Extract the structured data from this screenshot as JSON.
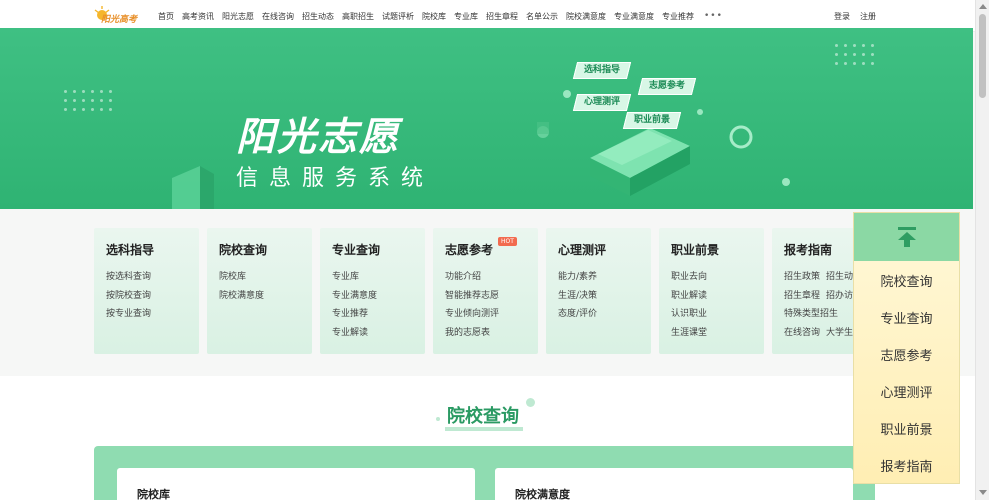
{
  "logo": {
    "text": "阳光高考"
  },
  "nav": {
    "items": [
      "首页",
      "高考资讯",
      "阳光志愿",
      "在线咨询",
      "招生动态",
      "高职招生",
      "试题评析",
      "院校库",
      "专业库",
      "招生章程",
      "名单公示",
      "院校满意度",
      "专业满意度",
      "专业推荐"
    ],
    "more": "•••"
  },
  "auth": {
    "login": "登录",
    "register": "注册"
  },
  "banner": {
    "title": "阳光志愿",
    "subtitle": "信息服务系统",
    "tags": [
      "选科指导",
      "志愿参考",
      "心理测评",
      "职业前景"
    ]
  },
  "categories": [
    {
      "title": "选科指导",
      "links": [
        "按选科查询",
        "按院校查询",
        "按专业查询"
      ]
    },
    {
      "title": "院校查询",
      "links": [
        "院校库",
        "院校满意度"
      ]
    },
    {
      "title": "专业查询",
      "links": [
        "专业库",
        "专业满意度",
        "专业推荐",
        "专业解读"
      ]
    },
    {
      "title": "志愿参考",
      "badge": "HOT",
      "links": [
        "功能介绍",
        "智能推荐志愿",
        "专业倾向测评",
        "我的志愿表"
      ]
    },
    {
      "title": "心理测评",
      "links": [
        "能力/素养",
        "生涯/决策",
        "态度/评价"
      ]
    },
    {
      "title": "职业前景",
      "links": [
        "职业去向",
        "职业解读",
        "认识职业",
        "生涯课堂"
      ]
    },
    {
      "title": "报考指南",
      "pairs": [
        [
          "招生政策",
          "招生动"
        ],
        [
          "招生章程",
          "招办访"
        ],
        [
          "特殊类型招生",
          ""
        ],
        [
          "在线咨询",
          "大学生"
        ]
      ]
    }
  ],
  "section": {
    "title": "院校查询",
    "cards": [
      "院校库",
      "院校满意度"
    ]
  },
  "float_menu": {
    "items": [
      "院校查询",
      "专业查询",
      "志愿参考",
      "心理测评",
      "职业前景",
      "报考指南"
    ]
  },
  "colors": {
    "brand_green": "#3fc083",
    "float_bg": "#ffeeb3",
    "hot": "#f26b4f"
  }
}
